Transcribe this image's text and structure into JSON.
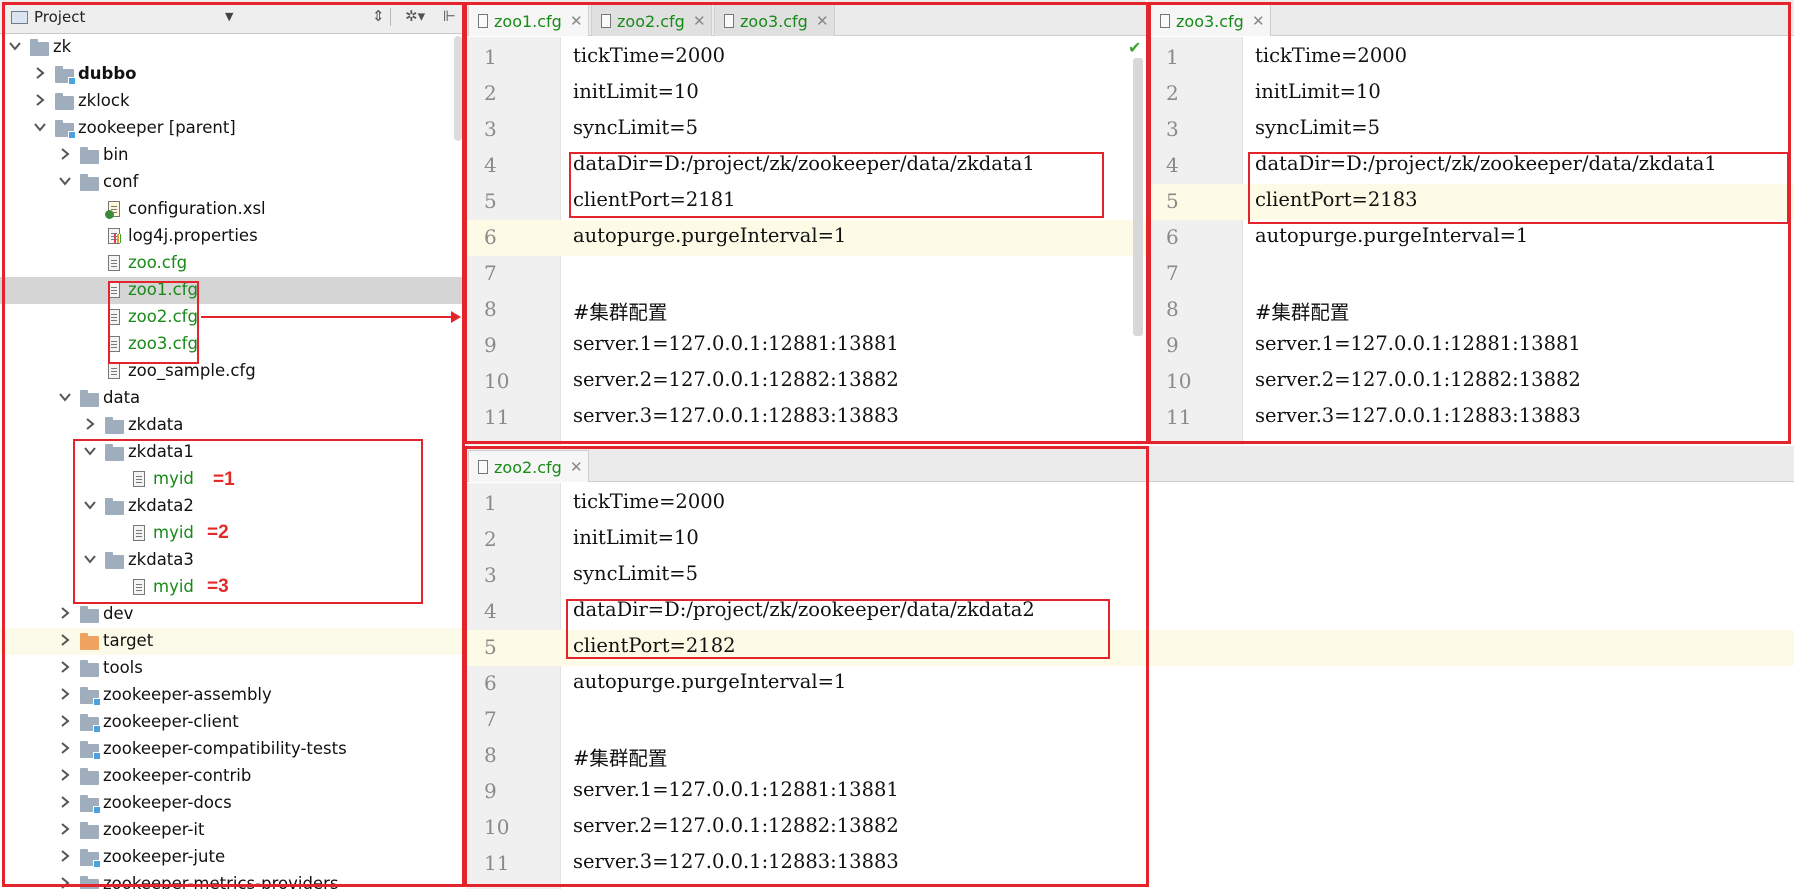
{
  "project": {
    "title": "Project",
    "tree": [
      {
        "label": "zk",
        "depth": 0,
        "arrow": "down",
        "icon": "folder"
      },
      {
        "label": "dubbo",
        "depth": 1,
        "arrow": "right",
        "icon": "module-folder",
        "bold": true
      },
      {
        "label": "zklock",
        "depth": 1,
        "arrow": "right",
        "icon": "folder"
      },
      {
        "label": "zookeeper",
        "suffix": " [parent]",
        "depth": 1,
        "arrow": "down",
        "icon": "module-folder"
      },
      {
        "label": "bin",
        "depth": 2,
        "arrow": "right",
        "icon": "folder"
      },
      {
        "label": "conf",
        "depth": 2,
        "arrow": "down",
        "icon": "folder"
      },
      {
        "label": "configuration.xsl",
        "depth": 3,
        "icon": "xsl-file"
      },
      {
        "label": "log4j.properties",
        "depth": 3,
        "icon": "properties-file"
      },
      {
        "label": "zoo.cfg",
        "depth": 3,
        "icon": "text-file",
        "green": true
      },
      {
        "label": "zoo1.cfg",
        "depth": 3,
        "icon": "text-file",
        "green": true,
        "selected": true
      },
      {
        "label": "zoo2.cfg",
        "depth": 3,
        "icon": "text-file",
        "green": true
      },
      {
        "label": "zoo3.cfg",
        "depth": 3,
        "icon": "text-file",
        "green": true
      },
      {
        "label": "zoo_sample.cfg",
        "depth": 3,
        "icon": "text-file"
      },
      {
        "label": "data",
        "depth": 2,
        "arrow": "down",
        "icon": "folder"
      },
      {
        "label": "zkdata",
        "depth": 3,
        "arrow": "right",
        "icon": "folder"
      },
      {
        "label": "zkdata1",
        "depth": 3,
        "arrow": "down",
        "icon": "folder"
      },
      {
        "label": "myid",
        "depth": 4,
        "icon": "text-file",
        "green": true
      },
      {
        "label": "zkdata2",
        "depth": 3,
        "arrow": "down",
        "icon": "folder"
      },
      {
        "label": "myid",
        "depth": 4,
        "icon": "text-file",
        "green": true
      },
      {
        "label": "zkdata3",
        "depth": 3,
        "arrow": "down",
        "icon": "folder"
      },
      {
        "label": "myid",
        "depth": 4,
        "icon": "text-file",
        "green": true
      },
      {
        "label": "dev",
        "depth": 2,
        "arrow": "right",
        "icon": "folder"
      },
      {
        "label": "target",
        "depth": 2,
        "arrow": "right",
        "icon": "orange-folder",
        "highlight": true
      },
      {
        "label": "tools",
        "depth": 2,
        "arrow": "right",
        "icon": "folder"
      },
      {
        "label": "zookeeper-assembly",
        "depth": 2,
        "arrow": "right",
        "icon": "module-folder"
      },
      {
        "label": "zookeeper-client",
        "depth": 2,
        "arrow": "right",
        "icon": "module-folder"
      },
      {
        "label": "zookeeper-compatibility-tests",
        "depth": 2,
        "arrow": "right",
        "icon": "module-folder"
      },
      {
        "label": "zookeeper-contrib",
        "depth": 2,
        "arrow": "right",
        "icon": "folder"
      },
      {
        "label": "zookeeper-docs",
        "depth": 2,
        "arrow": "right",
        "icon": "module-folder"
      },
      {
        "label": "zookeeper-it",
        "depth": 2,
        "arrow": "right",
        "icon": "folder"
      },
      {
        "label": "zookeeper-jute",
        "depth": 2,
        "arrow": "right",
        "icon": "module-folder"
      },
      {
        "label": "zookeeper-metrics-providers",
        "depth": 2,
        "arrow": "right",
        "icon": "folder"
      }
    ],
    "annotations": [
      "=1",
      "=2",
      "=3"
    ]
  },
  "editors": {
    "left_top": {
      "tabs": [
        {
          "label": "zoo1.cfg",
          "active": true
        },
        {
          "label": "zoo2.cfg",
          "active": false
        },
        {
          "label": "zoo3.cfg",
          "active": false
        }
      ],
      "caret_line": 6,
      "lines": [
        "tickTime=2000",
        "initLimit=10",
        "syncLimit=5",
        "dataDir=D:/project/zk/zookeeper/data/zkdata1",
        "clientPort=2181",
        "autopurge.purgeInterval=1",
        "",
        "#集群配置",
        "server.1=127.0.0.1:12881:13881",
        "server.2=127.0.0.1:12882:13882",
        "server.3=127.0.0.1:12883:13883"
      ]
    },
    "right_top": {
      "tabs": [
        {
          "label": "zoo3.cfg",
          "active": true
        }
      ],
      "caret_line": 5,
      "lines": [
        "tickTime=2000",
        "initLimit=10",
        "syncLimit=5",
        "dataDir=D:/project/zk/zookeeper/data/zkdata1",
        "clientPort=2183",
        "autopurge.purgeInterval=1",
        "",
        "#集群配置",
        "server.1=127.0.0.1:12881:13881",
        "server.2=127.0.0.1:12882:13882",
        "server.3=127.0.0.1:12883:13883"
      ]
    },
    "bottom": {
      "tabs": [
        {
          "label": "zoo2.cfg",
          "active": true
        }
      ],
      "caret_line": 5,
      "lines": [
        "tickTime=2000",
        "initLimit=10",
        "syncLimit=5",
        "dataDir=D:/project/zk/zookeeper/data/zkdata2",
        "clientPort=2182",
        "autopurge.purgeInterval=1",
        "",
        "#集群配置",
        "server.1=127.0.0.1:12881:13881",
        "server.2=127.0.0.1:12882:13882",
        "server.3=127.0.0.1:12883:13883"
      ]
    }
  },
  "colors": {
    "annotation_red": "#e3242b",
    "vcs_green": "#178a17",
    "caret_row": "#fdfae5",
    "selection": "#d5d5d5"
  }
}
